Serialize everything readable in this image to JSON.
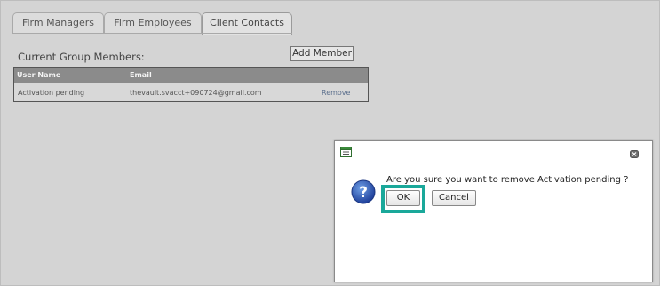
{
  "tabs": [
    {
      "label": "Firm Managers",
      "active": false
    },
    {
      "label": "Firm Employees",
      "active": false
    },
    {
      "label": "Client Contacts",
      "active": true
    }
  ],
  "group": {
    "title": "Current Group Members:",
    "add_button_label": "Add Member"
  },
  "table": {
    "columns": [
      "User Name",
      "Email"
    ],
    "rows": [
      {
        "user_name": "Activation pending",
        "email": "thevault.svacct+090724@gmail.com",
        "action": "Remove"
      }
    ]
  },
  "dialog": {
    "message": "Are you sure you want to remove Activation pending ?",
    "ok_label": "OK",
    "cancel_label": "Cancel",
    "icon": "help-icon",
    "highlight_color": "#1aa89a"
  },
  "colors": {
    "background": "#d4d4d4",
    "table_header": "#8b8b8b",
    "remove_link": "#5a6e8c"
  }
}
